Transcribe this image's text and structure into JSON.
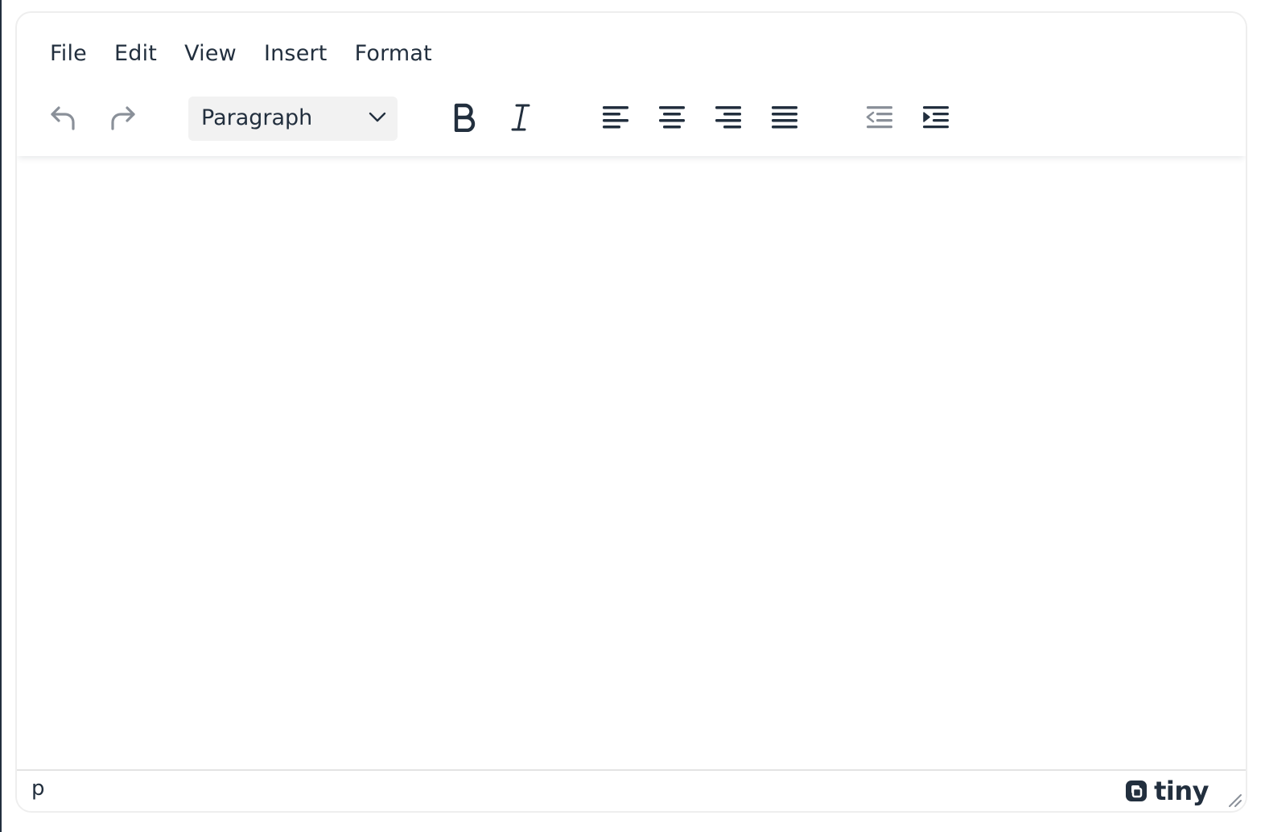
{
  "menubar": {
    "items": [
      {
        "label": "File"
      },
      {
        "label": "Edit"
      },
      {
        "label": "View"
      },
      {
        "label": "Insert"
      },
      {
        "label": "Format"
      }
    ]
  },
  "toolbar": {
    "block_format": {
      "selected": "Paragraph"
    },
    "buttons": [
      {
        "icon": "undo-icon",
        "enabled": false
      },
      {
        "icon": "redo-icon",
        "enabled": false
      },
      {
        "icon": "bold-icon",
        "enabled": true
      },
      {
        "icon": "italic-icon",
        "enabled": true
      },
      {
        "icon": "align-left-icon",
        "enabled": true
      },
      {
        "icon": "align-center-icon",
        "enabled": true
      },
      {
        "icon": "align-right-icon",
        "enabled": true
      },
      {
        "icon": "align-justify-icon",
        "enabled": true
      },
      {
        "icon": "outdent-icon",
        "enabled": false
      },
      {
        "icon": "indent-icon",
        "enabled": true
      }
    ]
  },
  "statusbar": {
    "path": "p",
    "brand": "tiny"
  },
  "colors": {
    "text": "#222f3e",
    "disabled": "#8a9099",
    "border": "#eeeeee",
    "select_bg": "#f2f2f2"
  }
}
